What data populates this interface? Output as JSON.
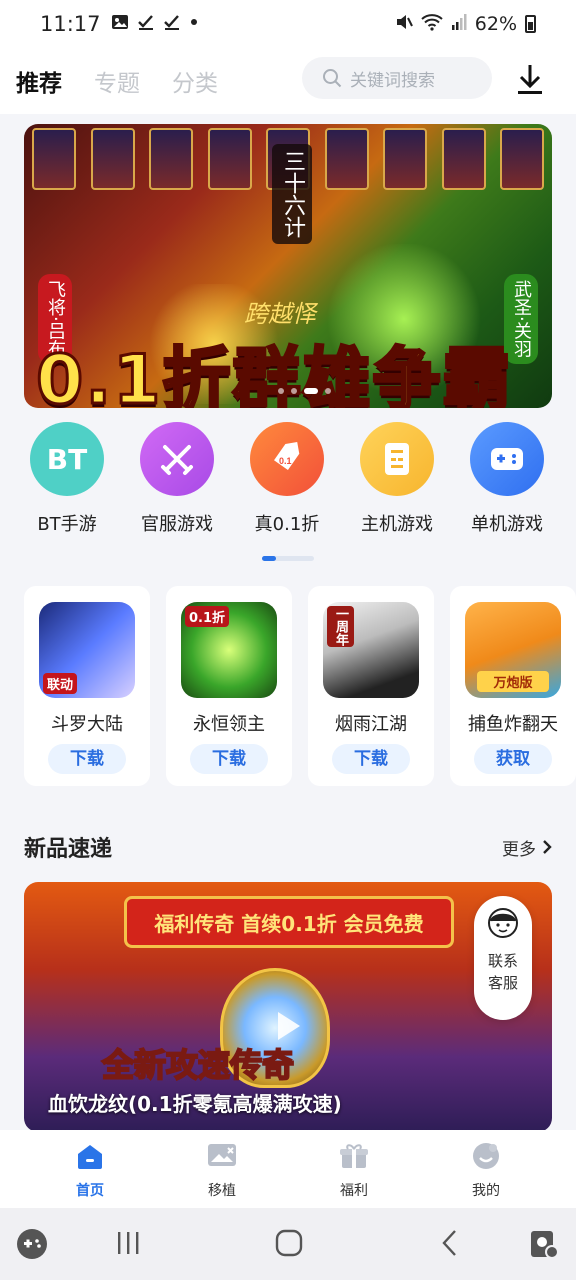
{
  "status_bar": {
    "time": "11:17",
    "battery": "62%",
    "icons": [
      "image-icon",
      "check-icon",
      "check-icon",
      "dot-icon"
    ],
    "right_icons": [
      "mute-icon",
      "wifi-icon",
      "signal-icon",
      "battery-icon"
    ]
  },
  "header": {
    "tabs": [
      {
        "label": "推荐",
        "active": true
      },
      {
        "label": "专题",
        "active": false
      },
      {
        "label": "分类",
        "active": false
      }
    ],
    "search_placeholder": "关键词搜索",
    "download_icon": "download-icon"
  },
  "banner": {
    "headline": "0.1折群雄争霸",
    "sub": "跨越怿",
    "left_tag": "飞将·吕布",
    "right_tag": "武圣·关羽",
    "center_tag": "三十六计",
    "page_count": 4,
    "active_page": 3
  },
  "categories": [
    {
      "label": "BT手游",
      "icon": "BT",
      "color": "#4fd0c6"
    },
    {
      "label": "官服游戏",
      "icon": "swords-icon",
      "color": "#c455f0"
    },
    {
      "label": "真0.1折",
      "icon": "tag-icon",
      "color": "#f86a3a"
    },
    {
      "label": "主机游戏",
      "icon": "console-icon",
      "color": "#f9c23c"
    },
    {
      "label": "单机游戏",
      "icon": "gamepad-icon",
      "color": "#3f86f6"
    }
  ],
  "games": [
    {
      "name": "斗罗大陆",
      "button": "下载",
      "tag": "联动"
    },
    {
      "name": "永恒领主",
      "button": "下载",
      "tag": "0.1折"
    },
    {
      "name": "烟雨江湖",
      "button": "下载",
      "tag": "一周年"
    },
    {
      "name": "捕鱼炸翻天",
      "button": "获取",
      "tag": "万炮版"
    }
  ],
  "section": {
    "title": "新品速递",
    "more": "更多"
  },
  "promo": {
    "ribbon": "福利传奇 首续0.1折 会员免费",
    "big_text": "全新攻速传奇",
    "caption": "血饮龙纹(0.1折零氪高爆满攻速)"
  },
  "service": {
    "label_line1": "联系",
    "label_line2": "客服"
  },
  "bottom_nav": [
    {
      "label": "首页",
      "active": true
    },
    {
      "label": "移植",
      "active": false
    },
    {
      "label": "福利",
      "active": false
    },
    {
      "label": "我的",
      "active": false
    }
  ]
}
